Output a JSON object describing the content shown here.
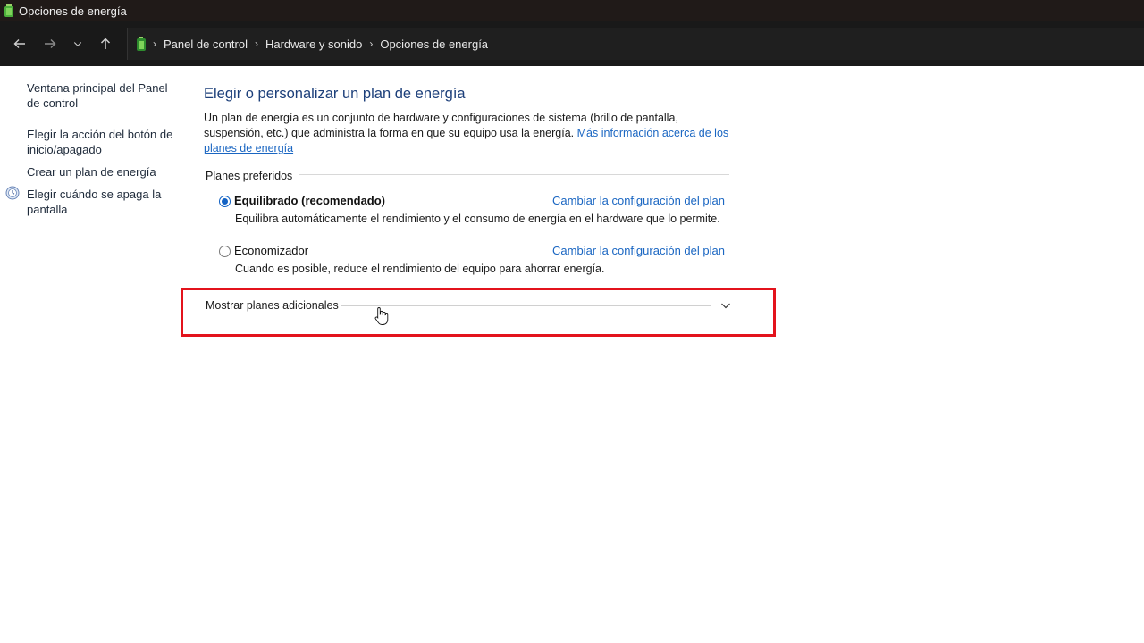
{
  "window": {
    "title": "Opciones de energía"
  },
  "nav": {
    "breadcrumbs": [
      "Panel de control",
      "Hardware y sonido",
      "Opciones de energía"
    ]
  },
  "sidebar": {
    "items": [
      {
        "label": "Ventana principal del Panel de control"
      },
      {
        "label": "Elegir la acción del botón de inicio/apagado"
      },
      {
        "label": "Crear un plan de energía"
      },
      {
        "label": "Elegir cuándo se apaga la pantalla"
      }
    ]
  },
  "main": {
    "heading": "Elegir o personalizar un plan de energía",
    "description": "Un plan de energía es un conjunto de hardware y configuraciones de sistema (brillo de pantalla, suspensión, etc.) que administra la forma en que su equipo usa la energía.",
    "description_link": "Más información acerca de los planes de energía",
    "group_label": "Planes preferidos",
    "plans": [
      {
        "name": "Equilibrado (recomendado)",
        "selected": true,
        "change_link": "Cambiar la configuración del plan",
        "description": "Equilibra automáticamente el rendimiento y el consumo de energía en el hardware que lo permite."
      },
      {
        "name": "Economizador",
        "selected": false,
        "change_link": "Cambiar la configuración del plan",
        "description": "Cuando es posible, reduce el rendimiento del equipo para ahorrar energía."
      }
    ],
    "more_plans": "Mostrar planes adicionales"
  },
  "colors": {
    "highlight": "#e3131c",
    "link": "#1a66c2",
    "heading": "#1c3f7a"
  }
}
